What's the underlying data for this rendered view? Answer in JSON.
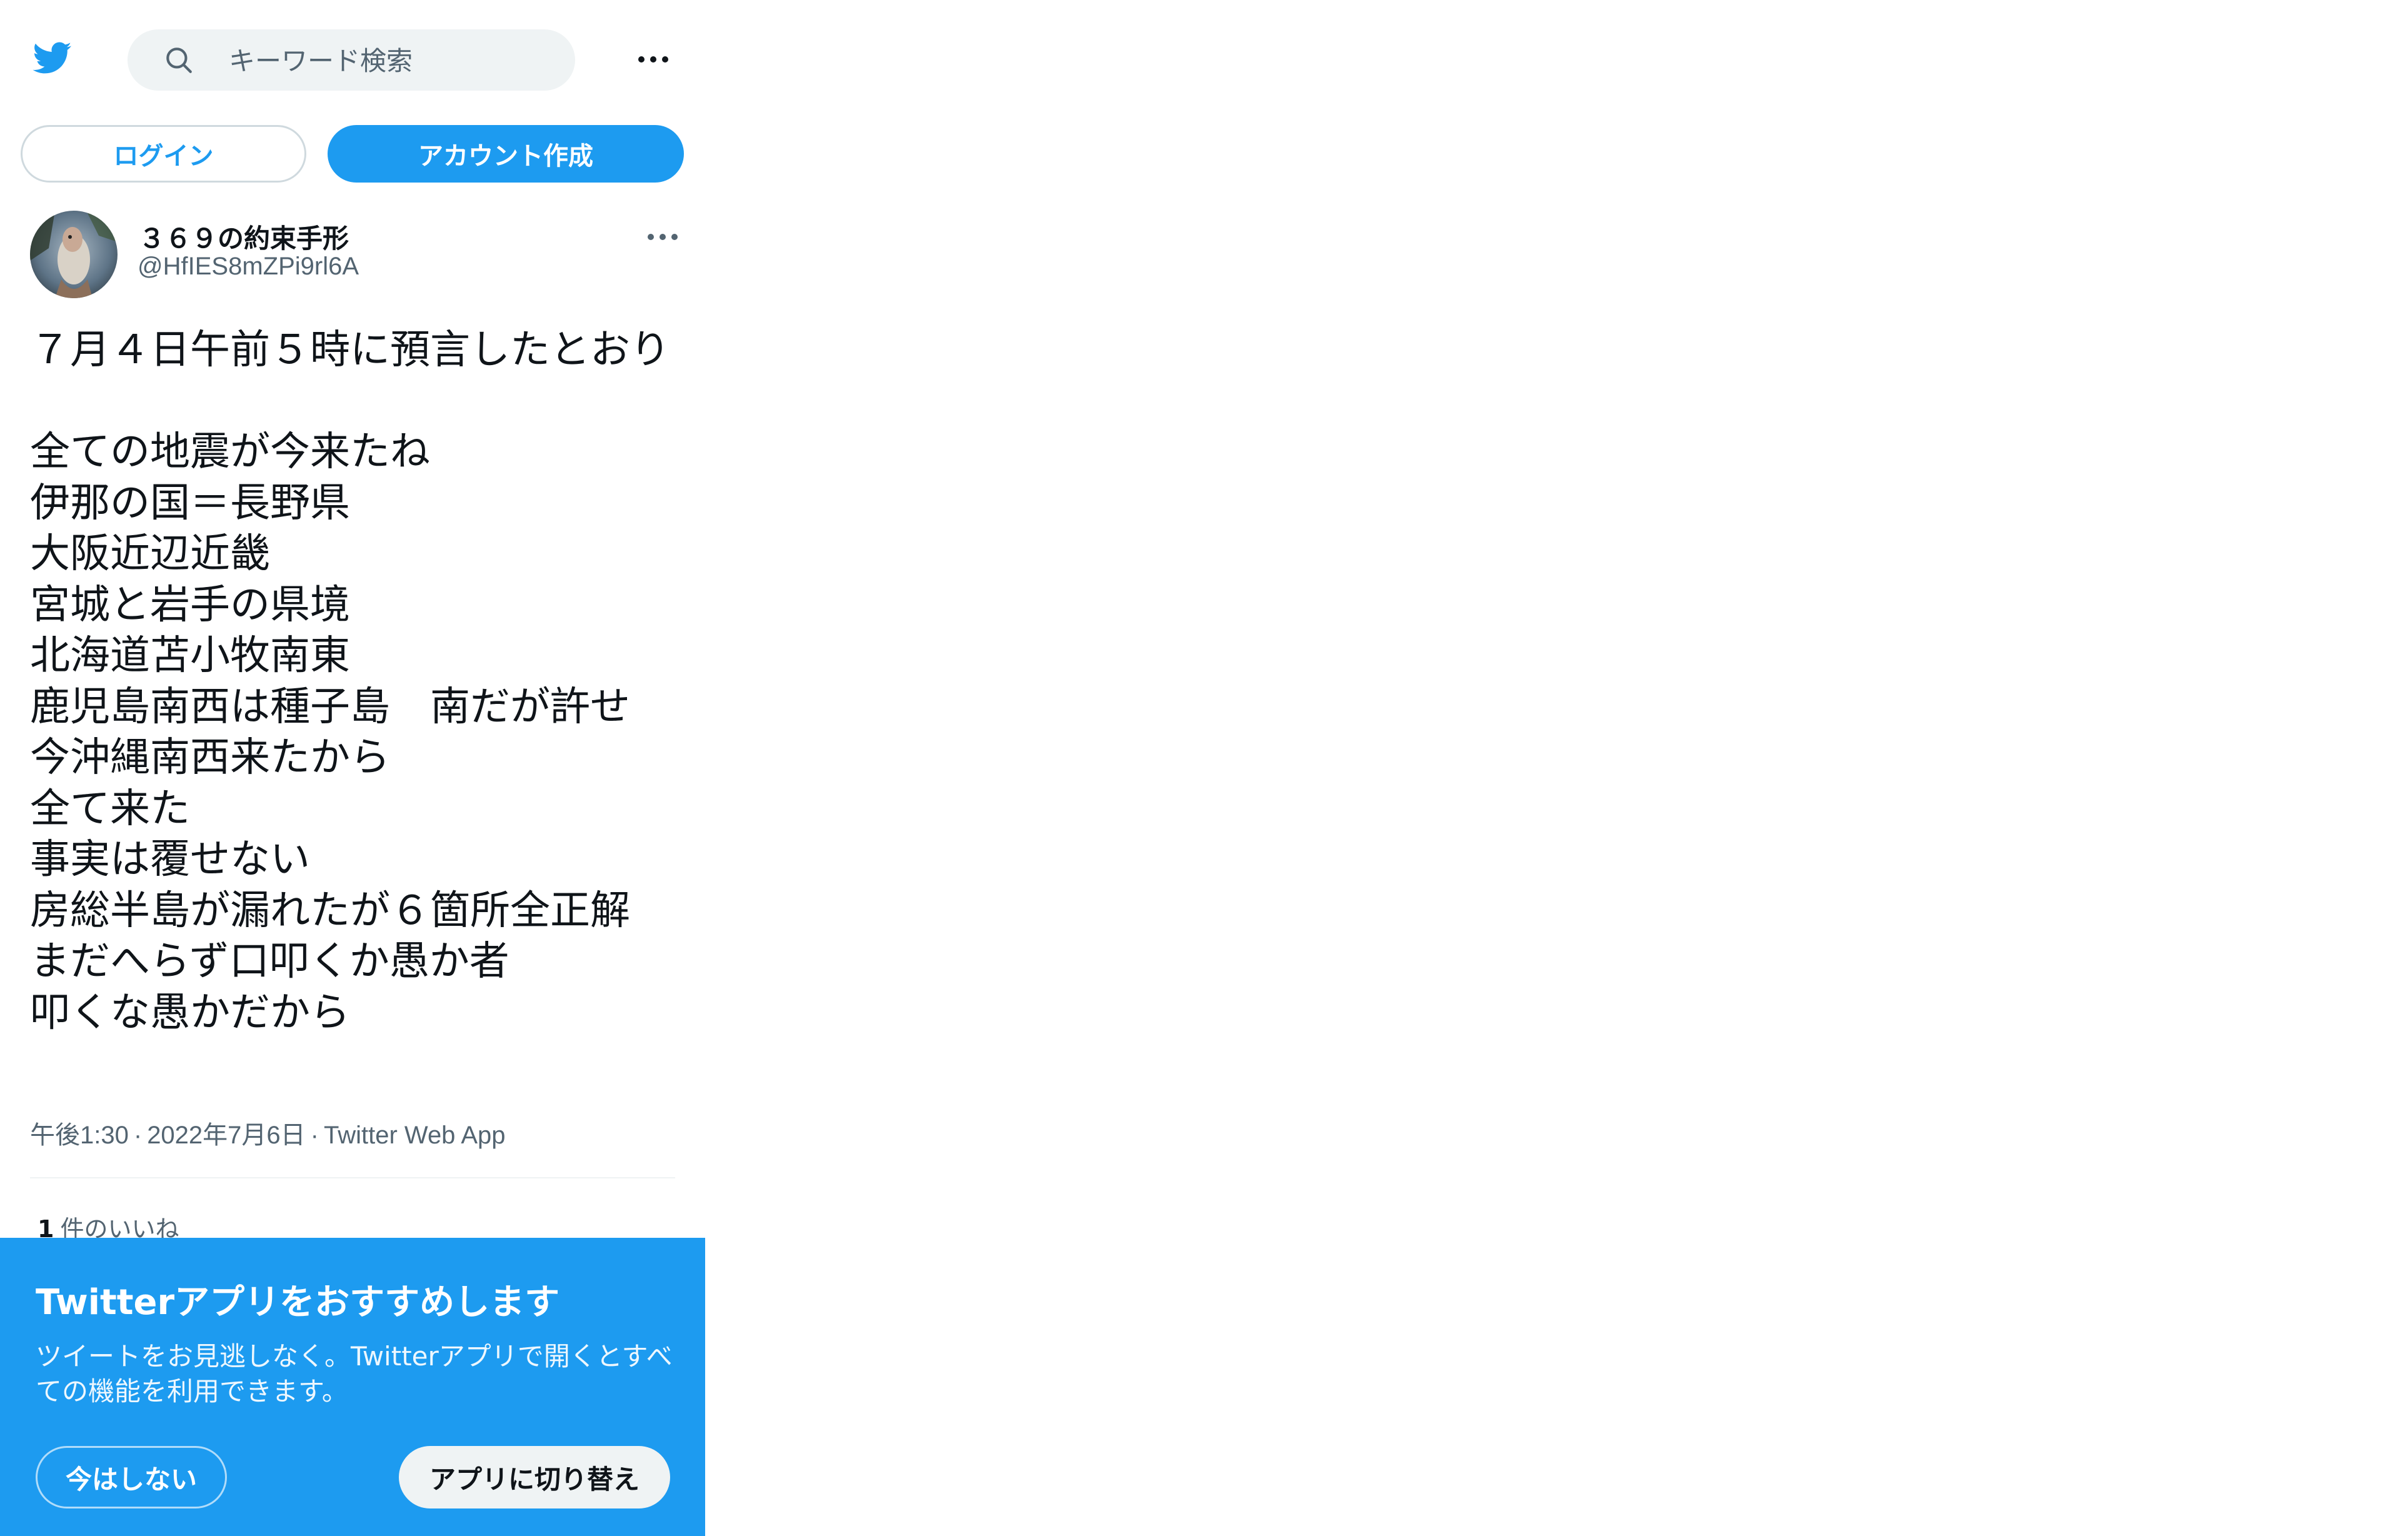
{
  "search": {
    "placeholder": "キーワード検索"
  },
  "auth": {
    "login_label": "ログイン",
    "signup_label": "アカウント作成"
  },
  "tweet": {
    "author": {
      "display_name": "３６９の約束手形",
      "handle": "@HfIES8mZPi9rl6A"
    },
    "body": {
      "first_paragraph": "７月４日午前５時に預言したとおり",
      "lines": [
        "全ての地震が今来たね",
        "伊那の国＝長野県",
        "大阪近辺近畿",
        "宮城と岩手の県境",
        "北海道苫小牧南東",
        "鹿児島南西は種子島　南だが許せ",
        "今沖縄南西来たから",
        "全て来た",
        "事実は覆せない",
        "房総半島が漏れたが６箇所全正解",
        "まだへらず口叩くか愚か者",
        "叩くな愚かだから"
      ]
    },
    "meta": {
      "time": "午後1:30",
      "separator": "·",
      "date": "2022年7月6日",
      "source": "Twitter Web App"
    },
    "likes": {
      "count": "1",
      "label": "件のいいね"
    }
  },
  "promo": {
    "title": "Twitterアプリをおすすめします",
    "description": "ツイートをお見逃しなく。Twitterアプリで開くとすべての機能を利用できます。",
    "not_now_label": "今はしない",
    "switch_label": "アプリに切り替え"
  },
  "icons": {
    "logo": "twitter-bird-icon",
    "search": "search-icon",
    "more": "more-horizontal-icon"
  },
  "colors": {
    "accent": "#1d9bf0",
    "text": "#0f1419",
    "secondary_text": "#536471"
  }
}
